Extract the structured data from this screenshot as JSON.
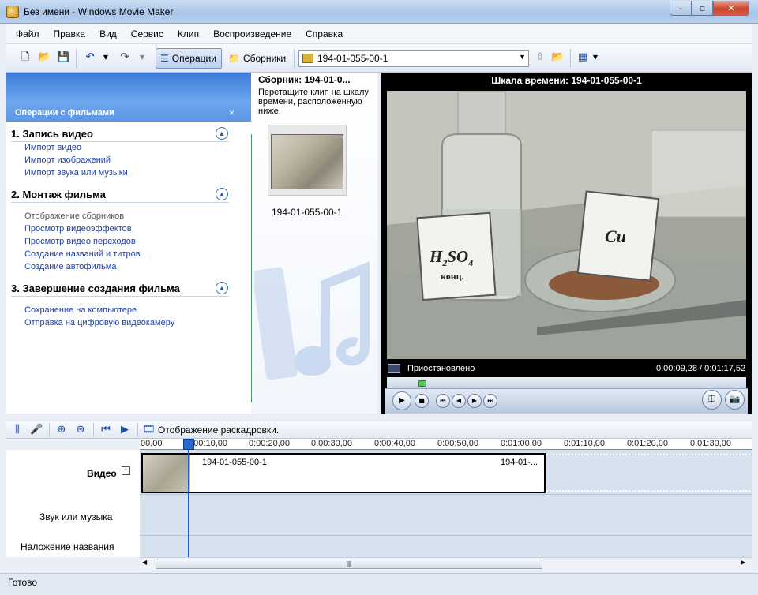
{
  "window": {
    "title": "Без имени - Windows Movie Maker",
    "min": "–",
    "max": "▫",
    "close": "✕"
  },
  "menu": [
    "Файл",
    "Правка",
    "Вид",
    "Сервис",
    "Клип",
    "Воспроизведение",
    "Справка"
  ],
  "toolbar": {
    "operations_label": "Операции",
    "collections_label": "Сборники",
    "collection_value": "194-01-055-00-1"
  },
  "tasks": {
    "header": "Операции с фильмами",
    "sections": [
      {
        "title": "1. Запись видео",
        "items": [
          "Импорт видео",
          "Импорт изображений",
          "Импорт звука или музыки"
        ]
      },
      {
        "title": "2. Монтаж фильма",
        "items": [
          "Отображение сборников",
          "Просмотр видеоэффектов",
          "Просмотр видео переходов",
          "Создание названий и титров",
          "Создание автофильма"
        ]
      },
      {
        "title": "3. Завершение создания фильма",
        "items": [
          "Сохранение на компьютере",
          "Отправка на цифровую видеокамеру"
        ]
      }
    ]
  },
  "collection": {
    "title": "Сборник: 194-01-0...",
    "hint": "Перетащите клип на шкалу времени, расположенную ниже.",
    "clip_label": "194-01-055-00-1"
  },
  "preview": {
    "title": "Шкала времени: 194-01-055-00-1",
    "status": "Приостановлено",
    "time": "0:00:09,28 / 0:01:17,52",
    "label1_main": "H",
    "label1_sub1": "2",
    "label1_mid": "SO",
    "label1_sub2": "4",
    "label1_note": "конц.",
    "label2": "Cu",
    "seek_position": 0.09
  },
  "timeline": {
    "storyboard_label": "Отображение раскадровки.",
    "ticks": [
      "00,00",
      "0:00:10,00",
      "0:00:20,00",
      "0:00:30,00",
      "0:00:40,00",
      "0:00:50,00",
      "0:01:00,00",
      "0:01:10,00",
      "0:01:20,00",
      "0:01:30,00"
    ],
    "tracks": {
      "video": "Видео",
      "audio": "Звук или музыка",
      "title": "Наложение названия"
    },
    "clip_start": "194-01-055-00-1",
    "clip_end": "194-01-..."
  },
  "statusbar": "Готово"
}
